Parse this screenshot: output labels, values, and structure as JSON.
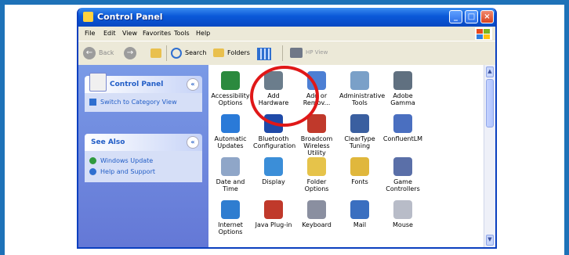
{
  "window": {
    "title": "Control Panel"
  },
  "menus": [
    "File",
    "Edit",
    "View",
    "Favorites",
    "Tools",
    "Help"
  ],
  "toolbar": {
    "back": "Back",
    "search": "Search",
    "folders": "Folders",
    "hp_view": "HP View"
  },
  "sidebar": {
    "panel_title": "Control Panel",
    "switch_view": "Switch to Category View",
    "see_also_title": "See Also",
    "links": [
      "Windows Update",
      "Help and Support"
    ]
  },
  "items": [
    {
      "label": "Accessibility Options",
      "icon": "accessibility-icon",
      "color": "#2b8a3e"
    },
    {
      "label": "Add Hardware",
      "icon": "add-hardware-icon",
      "color": "#6b7d8c"
    },
    {
      "label": "Add or Remov...",
      "icon": "add-remove-programs-icon",
      "color": "#4c7fd4"
    },
    {
      "label": "Administrative Tools",
      "icon": "administrative-tools-icon",
      "color": "#7aa0c8"
    },
    {
      "label": "Adobe Gamma",
      "icon": "monitor-icon",
      "color": "#607080"
    },
    {
      "label": "Automatic Updates",
      "icon": "globe-icon",
      "color": "#2a7ad8"
    },
    {
      "label": "Bluetooth Configuration",
      "icon": "bluetooth-icon",
      "color": "#1f4aa8"
    },
    {
      "label": "Broadcom Wireless Utility",
      "icon": "wireless-icon",
      "color": "#c0392b"
    },
    {
      "label": "ClearType Tuning",
      "icon": "cleartype-icon",
      "color": "#3a5fa0"
    },
    {
      "label": "ConfluentLM",
      "icon": "confluentlm-icon",
      "color": "#4a6fc0"
    },
    {
      "label": "Date and Time",
      "icon": "clock-icon",
      "color": "#8fa6c8"
    },
    {
      "label": "Display",
      "icon": "display-icon",
      "color": "#3b8ed8"
    },
    {
      "label": "Folder Options",
      "icon": "folder-icon",
      "color": "#e6c34a"
    },
    {
      "label": "Fonts",
      "icon": "fonts-icon",
      "color": "#e0b73c"
    },
    {
      "label": "Game Controllers",
      "icon": "joystick-icon",
      "color": "#5a6fa8"
    },
    {
      "label": "Internet Options",
      "icon": "internet-icon",
      "color": "#2f7dd0"
    },
    {
      "label": "Java Plug-in",
      "icon": "java-icon",
      "color": "#c0392b"
    },
    {
      "label": "Keyboard",
      "icon": "keyboard-icon",
      "color": "#8a8fa0"
    },
    {
      "label": "Mail",
      "icon": "mail-icon",
      "color": "#3a6fc0"
    },
    {
      "label": "Mouse",
      "icon": "mouse-icon",
      "color": "#b8bcc8"
    }
  ],
  "colors": {
    "frame": "#1e72b8",
    "titlebar": "#0a58d8",
    "highlight": "#e01818"
  }
}
